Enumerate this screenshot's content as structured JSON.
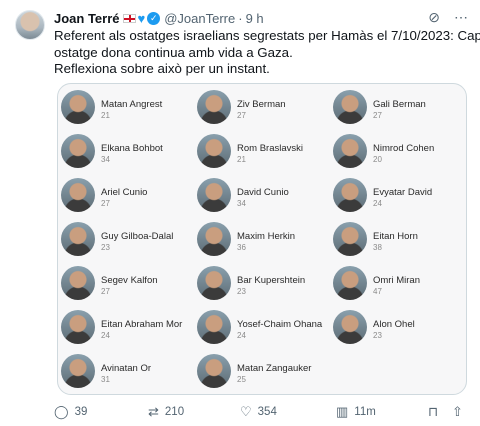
{
  "author": {
    "name": "Joan Terré",
    "heart_glyph": "♥",
    "verified_glyph": "✓",
    "handle": "@JoanTerre",
    "separator": "·",
    "time": "9 h"
  },
  "tweet": {
    "line1": "Referent als ostatges israelians segrestats per Hamàs el 7/10/2023: Cap",
    "line2": "ostatge dona continua amb vida a Gaza.",
    "line3": "Reflexiona sobre això per un instant."
  },
  "hostages": [
    {
      "name": "Matan Angrest",
      "age": "21"
    },
    {
      "name": "Ziv Berman",
      "age": "27"
    },
    {
      "name": "Gali Berman",
      "age": "27"
    },
    {
      "name": "Elkana Bohbot",
      "age": "34"
    },
    {
      "name": "Rom Braslavski",
      "age": "21"
    },
    {
      "name": "Nimrod Cohen",
      "age": "20"
    },
    {
      "name": "Ariel Cunio",
      "age": "27"
    },
    {
      "name": "David Cunio",
      "age": "34"
    },
    {
      "name": "Evyatar David",
      "age": "24"
    },
    {
      "name": "Guy Gilboa-Dalal",
      "age": "23"
    },
    {
      "name": "Maxim Herkin",
      "age": "36"
    },
    {
      "name": "Eitan Horn",
      "age": "38"
    },
    {
      "name": "Segev Kalfon",
      "age": "27"
    },
    {
      "name": "Bar Kupershtein",
      "age": "23"
    },
    {
      "name": "Omri Miran",
      "age": "47"
    },
    {
      "name": "Eitan Abraham Mor",
      "age": "24"
    },
    {
      "name": "Yosef-Chaim Ohana",
      "age": "24"
    },
    {
      "name": "Alon Ohel",
      "age": "23"
    },
    {
      "name": "Avinatan Or",
      "age": "31"
    },
    {
      "name": "Matan Zangauker",
      "age": "25"
    }
  ],
  "actions": {
    "replies": "39",
    "reposts": "210",
    "likes": "354",
    "views": "11m"
  },
  "icons": {
    "grok": "⊘",
    "more": "⋯",
    "reply": "◯",
    "repost": "⇄",
    "like": "♡",
    "views": "▥",
    "bookmark": "⊓",
    "share": "⇧"
  },
  "colors": {
    "accent": "#1d9bf0",
    "text": "#0f1419",
    "muted": "#536471"
  }
}
